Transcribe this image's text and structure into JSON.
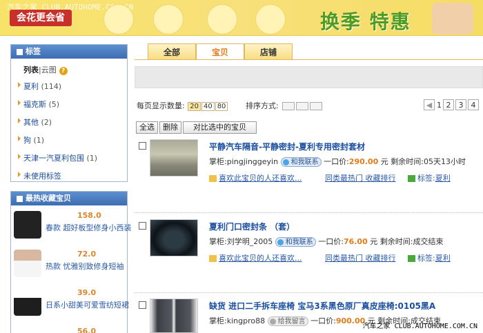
{
  "banner": {
    "watermark": "汽车之家 CLUB.AUTOHOME.COM.CN",
    "brand": "会花更会省",
    "promo": "换季 特惠"
  },
  "sidebar": {
    "tags_title": "标签",
    "view_list": "列表",
    "view_cloud": "云图",
    "tags": [
      {
        "label": "夏利",
        "count": "(114)"
      },
      {
        "label": "福克斯",
        "count": "(5)"
      },
      {
        "label": "其他",
        "count": "(2)"
      },
      {
        "label": "狗",
        "count": "(1)"
      },
      {
        "label": "天津一汽夏利包围",
        "count": "(1)"
      },
      {
        "label": "未使用标签",
        "count": ""
      }
    ],
    "fav_title": "最热收藏宝贝",
    "favs": [
      {
        "price": "158.0",
        "title": "春款 超好板型修身小西装"
      },
      {
        "price": "72.0",
        "title": "热款 忧雅别致修身短袖"
      },
      {
        "price": "39.0",
        "title": "日系小甜美可爱雪纺短裙"
      },
      {
        "price": "56.0",
        "title": ""
      }
    ]
  },
  "tabs": [
    {
      "label": "全部"
    },
    {
      "label": "宝贝"
    },
    {
      "label": "店铺"
    }
  ],
  "controls": {
    "per_page_label": "每页显示数量:",
    "per_page_options": [
      "20",
      "40",
      "80"
    ],
    "sort_label": "排序方式:",
    "pages": [
      "1",
      "2",
      "3",
      "4"
    ],
    "select_all": "全选",
    "delete": "删除",
    "compare": "对比选中的宝贝"
  },
  "items": [
    {
      "title": "平静汽车隔音-平静密封-夏利专用密封套材",
      "seller_label": "掌柜:",
      "seller": "pingjinggeyin",
      "contact": "和我联系",
      "price_label": "一口价:",
      "price": "290.00",
      "unit": "元",
      "time_label": "剩余时间:",
      "time": "05天13小时",
      "like": "喜欢此宝贝的人还喜欢...",
      "hot": "同类最热门 收藏排行",
      "tag_label": "标签:",
      "tag": "夏利"
    },
    {
      "title": "夏利门口密封条 （套）",
      "seller_label": "掌柜:",
      "seller": "刘学明_2005",
      "contact": "和我联系",
      "price_label": "一口价:",
      "price": "76.00",
      "unit": "元",
      "time_label": "剩余时间:",
      "time": "成交结束",
      "like": "喜欢此宝贝的人还喜欢...",
      "hot": "同类最热门 收藏排行",
      "tag_label": "标签:",
      "tag": "夏利"
    },
    {
      "title": "缺货 进口二手拆车座椅 宝马3系黑色原厂真皮座椅:0105黑A",
      "seller_label": "掌柜:",
      "seller": "kingpro88",
      "contact": "给我留言",
      "price_label": "一口价:",
      "price": "900.00",
      "unit": "元",
      "time_label": "剩余时间:",
      "time": "成交结束"
    }
  ],
  "footer_mark": "汽车之家  CLUB.AUTOHOME.COM.CN"
}
